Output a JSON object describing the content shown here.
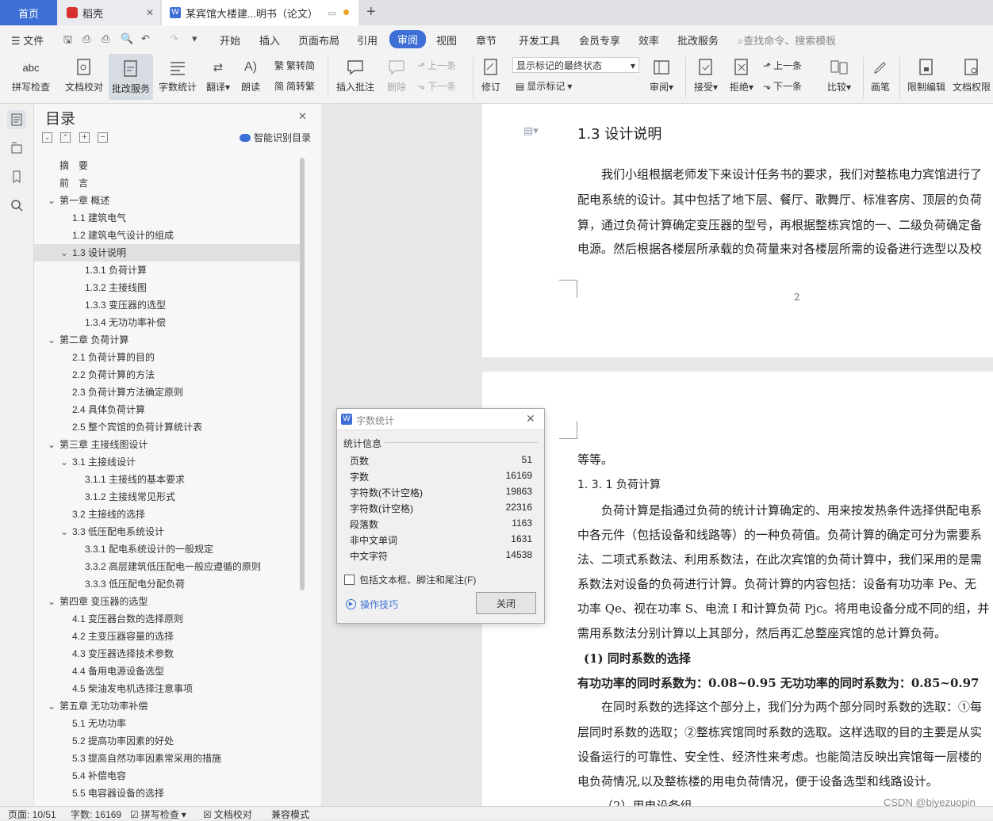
{
  "tabs": {
    "home": "首页",
    "daoke": "稻壳",
    "doc": "某宾馆大楼建...明书（论文）"
  },
  "menu": {
    "file": "文件",
    "items": [
      "开始",
      "插入",
      "页面布局",
      "引用",
      "审阅",
      "视图",
      "章节",
      "开发工具",
      "会员专享",
      "效率",
      "批改服务"
    ],
    "active": "审阅",
    "search_placeholder": "查找命令、搜索模板"
  },
  "ribbon": {
    "spell_check": "拼写检查",
    "doc_check": "文档校对",
    "review_service": "批改服务",
    "word_count": "字数统计",
    "translate": "翻译",
    "read_aloud": "朗读",
    "trad_to_simp": "繁转简",
    "simp_to_trad": "简转繁",
    "insert_comment": "插入批注",
    "delete": "删除",
    "prev": "上一条",
    "next": "下一条",
    "track_changes": "修订",
    "markup_mode": "显示标记的最终状态",
    "show_markup": "显示标记",
    "review": "审阅",
    "accept": "接受",
    "reject": "拒绝",
    "prev2": "上一条",
    "next2": "下一条",
    "compare": "比较",
    "ink": "画笔",
    "restrict_edit": "限制编辑",
    "doc_permission": "文档权限"
  },
  "toc": {
    "title": "目录",
    "smart": "智能识别目录",
    "items": [
      {
        "label": "摘　要",
        "level": 0,
        "chev": ""
      },
      {
        "label": "前　言",
        "level": 0,
        "chev": ""
      },
      {
        "label": "第一章  概述",
        "level": 0,
        "chev": "v"
      },
      {
        "label": "1.1 建筑电气",
        "level": 1,
        "chev": ""
      },
      {
        "label": "1.2 建筑电气设计的组成",
        "level": 1,
        "chev": ""
      },
      {
        "label": "1.3 设计说明",
        "level": 1,
        "chev": "v",
        "selected": true
      },
      {
        "label": "1.3.1 负荷计算",
        "level": 2,
        "chev": ""
      },
      {
        "label": "1.3.2 主接线图",
        "level": 2,
        "chev": ""
      },
      {
        "label": "1.3.3 变压器的选型",
        "level": 2,
        "chev": ""
      },
      {
        "label": "1.3.4 无功功率补偿",
        "level": 2,
        "chev": ""
      },
      {
        "label": "第二章  负荷计算",
        "level": 0,
        "chev": "v"
      },
      {
        "label": "2.1 负荷计算的目的",
        "level": 1,
        "chev": ""
      },
      {
        "label": "2.2 负荷计算的方法",
        "level": 1,
        "chev": ""
      },
      {
        "label": "2.3 负荷计算方法确定原则",
        "level": 1,
        "chev": ""
      },
      {
        "label": "2.4 具体负荷计算",
        "level": 1,
        "chev": ""
      },
      {
        "label": "2.5  整个宾馆的负荷计算统计表",
        "level": 1,
        "chev": ""
      },
      {
        "label": "第三章  主接线图设计",
        "level": 0,
        "chev": "v"
      },
      {
        "label": "3.1  主接线设计",
        "level": 1,
        "chev": "v"
      },
      {
        "label": "3.1.1  主接线的基本要求",
        "level": 2,
        "chev": ""
      },
      {
        "label": "3.1.2  主接线常见形式",
        "level": 2,
        "chev": ""
      },
      {
        "label": "3.2 主接线的选择",
        "level": 1,
        "chev": ""
      },
      {
        "label": "3.3  低压配电系统设计",
        "level": 1,
        "chev": "v"
      },
      {
        "label": "3.3.1 配电系统设计的一般规定",
        "level": 2,
        "chev": ""
      },
      {
        "label": "3.3.2 高层建筑低压配电一般应遵循的原则",
        "level": 2,
        "chev": ""
      },
      {
        "label": "3.3.3  低压配电分配负荷",
        "level": 2,
        "chev": ""
      },
      {
        "label": "第四章  变压器的选型",
        "level": 0,
        "chev": "v"
      },
      {
        "label": "4.1  变压器台数的选择原则",
        "level": 1,
        "chev": ""
      },
      {
        "label": "4.2 主变压器容量的选择",
        "level": 1,
        "chev": ""
      },
      {
        "label": "4.3 变压器选择技术参数",
        "level": 1,
        "chev": ""
      },
      {
        "label": "4.4 备用电源设备选型",
        "level": 1,
        "chev": ""
      },
      {
        "label": "4.5  柴油发电机选择注意事项",
        "level": 1,
        "chev": ""
      },
      {
        "label": "第五章  无功功率补偿",
        "level": 0,
        "chev": "v"
      },
      {
        "label": "5.1  无功功率",
        "level": 1,
        "chev": ""
      },
      {
        "label": "5.2  提高功率因素的好处",
        "level": 1,
        "chev": ""
      },
      {
        "label": "5.3 提高自然功率因素常采用的措施",
        "level": 1,
        "chev": ""
      },
      {
        "label": "5.4 补偿电容",
        "level": 1,
        "chev": ""
      },
      {
        "label": "5.5 电容器设备的选择",
        "level": 1,
        "chev": ""
      }
    ]
  },
  "page1": {
    "heading": "1.3 设计说明",
    "lines": [
      "我们小组根据老师发下来设计任务书的要求，我们对整栋电力宾馆进行了",
      "配电系统的设计。其中包括了地下层、餐厅、歌舞厅、标准客房、顶层的负荷",
      "算，通过负荷计算确定变压器的型号，再根据整栋宾馆的一、二级负荷确定备",
      "电源。然后根据各楼层所承载的负荷量来对各楼层所需的设备进行选型以及校"
    ],
    "page_no": "2"
  },
  "page2": {
    "cont": "等等。",
    "subheading": "1. 3. 1 负荷计算",
    "para1": [
      "负荷计算是指通过负荷的统计计算确定的、用来按发热条件选择供配电系",
      "中各元件（包括设备和线路等）的一种负荷值。负荷计算的确定可分为需要系",
      "法、二项式系数法、利用系数法，在此次宾馆的负荷计算中，我们采用的是需",
      "系数法对设备的负荷进行计算。负荷计算的内容包括：设备有功功率 Pe、无",
      "功率 Qe、视在功率 S、电流 I 和计算负荷 Pjc。将用电设备分成不同的组，并",
      "需用系数法分别计算以上其部分，然后再汇总整座宾馆的总计算负荷。"
    ],
    "bold1": "(1)  同时系数的选择",
    "bold2": "有功功率的同时系数为：0.08~0.95      无功功率的同时系数为：0.85~0.97",
    "para2": [
      "在同时系数的选择这个部分上，我们分为两个部分同时系数的选取：①每",
      "层同时系数的选取；②整栋宾馆同时系数的选取。这样选取的目的主要是从实",
      "设备运行的可靠性、安全性、经济性来考虑。也能简洁反映出宾馆每一层楼的",
      "电负荷情况,以及整栋楼的用电负荷情况，便于设备选型和线路设计。"
    ],
    "last": "（2）用电设备组"
  },
  "dialog": {
    "title": "字数统计",
    "section": "统计信息",
    "rows": [
      {
        "k": "页数",
        "v": "51"
      },
      {
        "k": "字数",
        "v": "16169"
      },
      {
        "k": "字符数(不计空格)",
        "v": "19863"
      },
      {
        "k": "字符数(计空格)",
        "v": "22316"
      },
      {
        "k": "段落数",
        "v": "1163"
      },
      {
        "k": "非中文单词",
        "v": "1631"
      },
      {
        "k": "中文字符",
        "v": "14538"
      }
    ],
    "checkbox": "包括文本框、脚注和尾注(F)",
    "tips": "操作技巧",
    "close": "关闭"
  },
  "status": {
    "page": "页面: 10/51",
    "words": "字数: 16169",
    "spell": "拼写检查",
    "doc_check": "文档校对",
    "compat": "兼容模式"
  },
  "watermark": "CSDN @biyezuopin"
}
